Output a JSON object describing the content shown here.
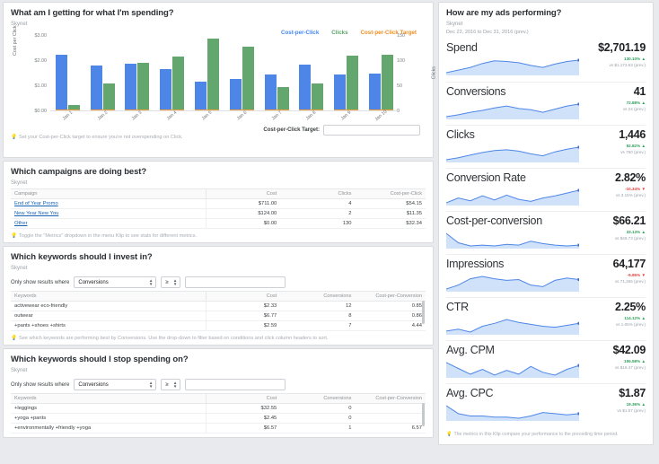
{
  "colors": {
    "cpc_blue": "#4e86e8",
    "clicks_green": "#63a76f",
    "target_orange": "#f2a03d",
    "link_blue": "#1763b6",
    "up_green": "#2e9e5b",
    "down_red": "#e03e3e"
  },
  "chart_klip": {
    "title": "What am I getting for what I'm spending?",
    "subtitle": "Skynet",
    "target_label": "Cost-per-Click Target:",
    "target_value": "",
    "target_placeholder": "",
    "footnote": "Set your Cost-per-Click target to ensure you're not overspending on Click."
  },
  "chart_data": {
    "type": "bar",
    "title": "What am I getting for what I'm spending?",
    "xlabel": "",
    "ylabel": "Cost per Click",
    "y2label": "Clicks",
    "ylim": [
      0,
      3
    ],
    "y2lim": [
      0,
      150
    ],
    "grid": false,
    "legend_position": "top-right",
    "categories": [
      "Jan 1",
      "Jan 2",
      "Jan 3",
      "Jan 4",
      "Jan 5",
      "Jan 6",
      "Jan 7",
      "Jan 8",
      "Jan 9",
      "Jan 10"
    ],
    "y_ticks": [
      "$0.00",
      "$1.00",
      "$2.00",
      "$3.00"
    ],
    "y2_ticks": [
      "0",
      "50",
      "100",
      "150"
    ],
    "series": [
      {
        "name": "Cost-per-Click",
        "color": "#4e86e8",
        "axis": "left",
        "values": [
          2.21,
          1.77,
          1.84,
          1.66,
          1.13,
          1.24,
          1.43,
          1.81,
          1.42,
          1.47
        ]
      },
      {
        "name": "Clicks",
        "color": "#63a76f",
        "axis": "right",
        "values": [
          11,
          53,
          95,
          108,
          143,
          126,
          47,
          53,
          109,
          111
        ]
      },
      {
        "name": "Cost-per-Click Target",
        "color": "#f2a03d",
        "axis": "left",
        "values": [
          0,
          0,
          0,
          0,
          0,
          0,
          0,
          0,
          0,
          0
        ]
      }
    ]
  },
  "campaigns_klip": {
    "title": "Which campaigns are doing best?",
    "subtitle": "Skynet",
    "footnote": "Toggle the \"Metrics\" dropdown in the menu Klip to see stats for different metrics.",
    "columns": [
      "Campaign",
      "Cost",
      "Clicks",
      "Cost-per-Click"
    ],
    "rows": [
      {
        "campaign": "End of Year Promo",
        "cost": "$711.00",
        "clicks": "4",
        "cpc": "$54.15"
      },
      {
        "campaign": "New Year New You",
        "cost": "$124.00",
        "clicks": "2",
        "cpc": "$11.35"
      },
      {
        "campaign": "Other",
        "cost": "$0.00",
        "clicks": "130",
        "cpc": "$32.34"
      }
    ]
  },
  "invest_klip": {
    "title": "Which keywords should I invest in?",
    "subtitle": "Skynet",
    "filter_label": "Only show results where",
    "filter_metric": "Conversions",
    "filter_operator": "≥",
    "filter_value": "",
    "footnote": "See which keywords are performing best by Conversions. Use the drop-down to filter based on conditions and click column headers to sort.",
    "columns": [
      "Keywords",
      "Cost",
      "Conversions",
      "Cost-per-Conversion"
    ],
    "rows": [
      {
        "keyword": "activewear eco-friendly",
        "cost": "$2.33",
        "conversions": "12",
        "cpconv": "0.85"
      },
      {
        "keyword": "outwear",
        "cost": "$6.77",
        "conversions": "8",
        "cpconv": "0.86"
      },
      {
        "keyword": "+pants +shoes +shirts",
        "cost": "$2.59",
        "conversions": "7",
        "cpconv": "4.44"
      }
    ]
  },
  "stop_klip": {
    "title": "Which keywords should I stop spending on?",
    "subtitle": "Skynet",
    "filter_label": "Only show results where",
    "filter_metric": "Conversions",
    "filter_operator": "≥",
    "filter_value": "",
    "columns": [
      "Keywords",
      "Cost",
      "Conversions",
      "Cost-per-Conversion"
    ],
    "rows": [
      {
        "keyword": "+leggings",
        "cost": "$32.55",
        "conversions": "0",
        "cpconv": ""
      },
      {
        "keyword": "+yoga +pants",
        "cost": "$2.45",
        "conversions": "0",
        "cpconv": ""
      },
      {
        "keyword": "+environmentally +friendly +yoga",
        "cost": "$6.57",
        "conversions": "1",
        "cpconv": "6.57"
      }
    ]
  },
  "kpi_klip": {
    "title": "How are my ads performing?",
    "subtitle": "Skynet",
    "date_range": "Dec 22, 2016 to Dec 31, 2016 (prev.)",
    "footnote": "The metrics in this Klip compare your performance to the preceding time period.",
    "metrics": [
      {
        "name": "Spend",
        "value": "$2,701.19",
        "delta": "130.10%",
        "direction": "up",
        "prev": "vs $1,173.63 (prev.)",
        "spark": [
          8,
          12,
          16,
          22,
          26,
          25,
          23,
          19,
          16,
          21,
          25,
          27
        ]
      },
      {
        "name": "Conversions",
        "value": "41",
        "delta": "72.88%",
        "direction": "up",
        "prev": "vs 24 (prev.)",
        "spark": [
          6,
          9,
          13,
          16,
          20,
          23,
          19,
          17,
          13,
          18,
          23,
          26
        ]
      },
      {
        "name": "Clicks",
        "value": "1,446",
        "delta": "92.82%",
        "direction": "up",
        "prev": "vs 750 (prev.)",
        "spark": [
          7,
          10,
          14,
          18,
          21,
          22,
          20,
          16,
          13,
          19,
          23,
          26
        ]
      },
      {
        "name": "Conversion Rate",
        "value": "2.82%",
        "delta": "-10.34%",
        "direction": "down",
        "prev": "vs 3.15% (prev.)",
        "spark": [
          9,
          16,
          12,
          19,
          13,
          20,
          14,
          11,
          16,
          19,
          23,
          27
        ]
      },
      {
        "name": "Cost-per-conversion",
        "value": "$66.21",
        "delta": "33.13%",
        "direction": "up",
        "prev": "vs $49.73 (prev.)",
        "spark": [
          27,
          15,
          11,
          12,
          11,
          13,
          12,
          17,
          14,
          12,
          11,
          12
        ]
      },
      {
        "name": "Impressions",
        "value": "64,177",
        "delta": "-9.95%",
        "direction": "down",
        "prev": "vs 71,265 (prev.)",
        "spark": [
          8,
          13,
          21,
          24,
          21,
          19,
          20,
          13,
          11,
          19,
          22,
          20
        ]
      },
      {
        "name": "CTR",
        "value": "2.25%",
        "delta": "114.12%",
        "direction": "up",
        "prev": "vs 1.05% (prev.)",
        "spark": [
          13,
          15,
          12,
          18,
          21,
          25,
          22,
          20,
          18,
          17,
          19,
          21
        ]
      },
      {
        "name": "Avg. CPM",
        "value": "$42.09",
        "delta": "155.58%",
        "direction": "up",
        "prev": "vs $16.47 (prev.)",
        "spark": [
          24,
          18,
          12,
          17,
          11,
          16,
          12,
          20,
          14,
          11,
          17,
          21
        ]
      },
      {
        "name": "Avg. CPC",
        "value": "$1.87",
        "delta": "19.36%",
        "direction": "up",
        "prev": "vs $1.57 (prev.)",
        "spark": [
          21,
          14,
          12,
          12,
          11,
          11,
          10,
          12,
          15,
          14,
          13,
          14
        ]
      }
    ]
  }
}
